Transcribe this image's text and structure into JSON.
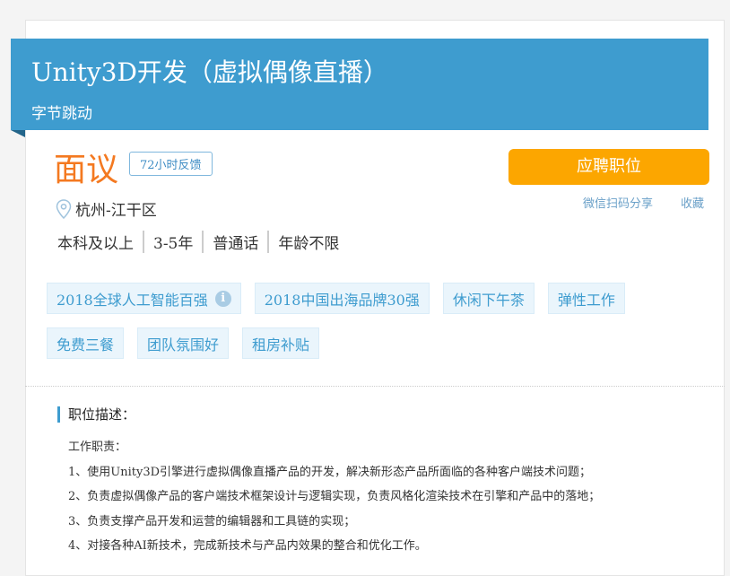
{
  "job": {
    "title": "Unity3D开发（虚拟偶像直播）",
    "company": "字节跳动",
    "salary": "面议",
    "feedback_badge": "72小时反馈",
    "location": "杭州-江干区",
    "requirements": [
      "本科及以上",
      "3-5年",
      "普通话",
      "年龄不限"
    ]
  },
  "actions": {
    "apply": "应聘职位",
    "share": "微信扫码分享",
    "favorite": "收藏"
  },
  "tags": [
    "2018全球人工智能百强",
    "2018中国出海品牌30强",
    "休闲下午茶",
    "弹性工作",
    "免费三餐",
    "团队氛围好",
    "租房补贴"
  ],
  "description": {
    "heading": "职位描述：",
    "subheading": "工作职责：",
    "lines": [
      "1、使用Unity3D引擎进行虚拟偶像直播产品的开发，解决新形态产品所面临的各种客户端技术问题；",
      "2、负责虚拟偶像产品的客户端技术框架设计与逻辑实现，负责风格化渲染技术在引擎和产品中的落地；",
      "3、负责支撑产品开发和运营的编辑器和工具链的实现；",
      "4、对接各种AI新技术，完成新技术与产品内效果的整合和优化工作。"
    ]
  },
  "colors": {
    "banner": "#3e9ccf",
    "salary": "#f47920",
    "apply": "#fca600"
  }
}
